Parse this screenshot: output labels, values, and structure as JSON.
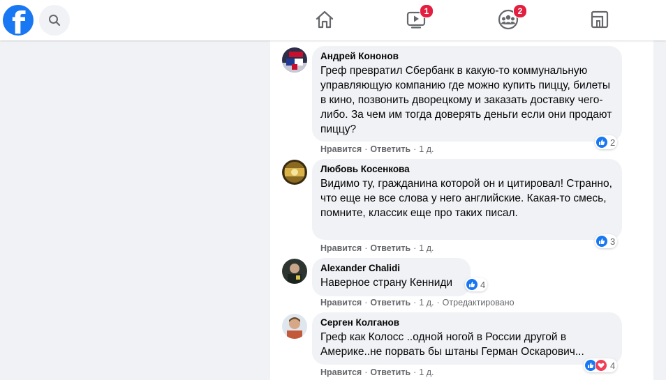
{
  "topbar": {
    "logo_letter": "f",
    "video_badge": "1",
    "groups_badge": "2"
  },
  "icons": {
    "logo": "facebook-logo-icon",
    "search": "search-icon",
    "home": "home-icon",
    "video": "video-icon",
    "groups": "groups-icon",
    "gaming": "gaming-icon",
    "like": "like-reaction-icon",
    "love": "love-reaction-icon"
  },
  "colors": {
    "brand": "#1877f2",
    "badge": "#e41e3f",
    "love": "#f33e58"
  },
  "comments": [
    {
      "author": "Андрей Кононов",
      "text": "Греф превратил Сбербанк в какую-то коммунальную управляющую компанию где можно купить пиццу, билеты в кино, позвонить дворецкому и заказать доставку чего-либо. За чем им тогда доверять деньги если они продают пиццу?",
      "reaction_count": "2",
      "like": "Нравится",
      "reply": "Ответить",
      "time": "1 д.",
      "edited": ""
    },
    {
      "author": "Любовь Косенкова",
      "text": "Видимо ту, гражданина которой он и цитировал! Странно, что еще не все слова у него английские. Какая-то смесь, помните, классик еще про таких писал.",
      "reaction_count": "3",
      "like": "Нравится",
      "reply": "Ответить",
      "time": "1 д.",
      "edited": ""
    },
    {
      "author": "Alexander Chalidi",
      "text": "Наверное страну Кенниди",
      "reaction_count": "4",
      "like": "Нравится",
      "reply": "Ответить",
      "time": "1 д.",
      "edited": "Отредактировано"
    },
    {
      "author": "Серген Колганов",
      "text": "Греф как Колосс ..одной ногой в России другой в Америке..не порвать бы штаны Герман Оскарович...",
      "reaction_count": "4",
      "like": "Нравится",
      "reply": "Ответить",
      "time": "1 д.",
      "edited": ""
    }
  ]
}
